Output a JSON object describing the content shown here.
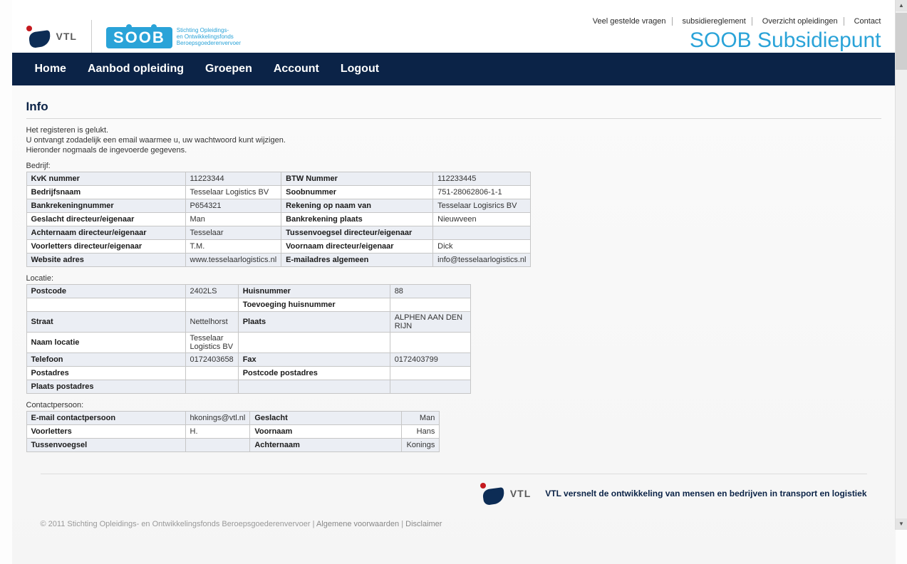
{
  "top_links": {
    "faq": "Veel gestelde vragen",
    "reglement": "subsidiereglement",
    "overzicht": "Overzicht opleidingen",
    "contact": "Contact"
  },
  "logos": {
    "vtl_text": "VTL",
    "soob_text": "SOOB",
    "soob_sub1": "Stichting Opleidings-",
    "soob_sub2": "en Ontwikkelingsfonds",
    "soob_sub3": "Beroepsgoederenvervoer"
  },
  "brand": "SOOB Subsidiepunt",
  "nav": {
    "home": "Home",
    "aanbod": "Aanbod opleiding",
    "groepen": "Groepen",
    "account": "Account",
    "logout": "Logout"
  },
  "title": "Info",
  "intro": {
    "l1": "Het registeren is gelukt.",
    "l2": "U ontvangt zodadelijk een email waarmee u, uw wachtwoord kunt wijzigen.",
    "l3": "Hieronder nogmaals de ingevoerde gegevens."
  },
  "company": {
    "section": "Bedrijf:",
    "rows": [
      {
        "l1": "KvK nummer",
        "v1": "11223344",
        "l2": "BTW Nummer",
        "v2": "112233445"
      },
      {
        "l1": "Bedrijfsnaam",
        "v1": "Tesselaar Logistics BV",
        "l2": "Soobnummer",
        "v2": "751-28062806-1-1"
      },
      {
        "l1": "Bankrekeningnummer",
        "v1": "P654321",
        "l2": "Rekening op naam van",
        "v2": "Tesselaar Logisrics BV"
      },
      {
        "l1": "Geslacht  directeur/eigenaar",
        "v1": "Man",
        "l2": "Bankrekening plaats",
        "v2": "Nieuwveen"
      },
      {
        "l1": "Achternaam  directeur/eigenaar",
        "v1": "Tesselaar",
        "l2": "Tussenvoegsel  directeur/eigenaar",
        "v2": ""
      },
      {
        "l1": "Voorletters  directeur/eigenaar",
        "v1": "T.M.",
        "l2": "Voornaam  directeur/eigenaar",
        "v2": "Dick"
      },
      {
        "l1": "Website adres",
        "v1": "www.tesselaarlogistics.nl",
        "l2": "E-mailadres algemeen",
        "v2": "info@tesselaarlogistics.nl"
      }
    ]
  },
  "location": {
    "section": "Locatie:",
    "rows": [
      {
        "l1": "Postcode",
        "v1": "2402LS",
        "l2": "Huisnummer",
        "v2": "88"
      },
      {
        "l1": "",
        "v1": "",
        "l2": "Toevoeging huisnummer",
        "v2": ""
      },
      {
        "l1": "Straat",
        "v1": "Nettelhorst",
        "l2": "Plaats",
        "v2": "ALPHEN AAN DEN RIJN"
      },
      {
        "l1": "Naam locatie",
        "v1": "Tesselaar Logistics BV",
        "l2": "",
        "v2": ""
      },
      {
        "l1": "Telefoon",
        "v1": "0172403658",
        "l2": "Fax",
        "v2": "0172403799"
      },
      {
        "l1": "Postadres",
        "v1": "",
        "l2": "Postcode postadres",
        "v2": ""
      },
      {
        "l1": "Plaats postadres",
        "v1": "",
        "l2": "",
        "v2": ""
      }
    ]
  },
  "contact": {
    "section": "Contactpersoon:",
    "rows": [
      {
        "l1": "E-mail contactpersoon",
        "v1": "hkonings@vtl.nl",
        "l2": "Geslacht",
        "v2": "Man"
      },
      {
        "l1": "Voorletters",
        "v1": "H.",
        "l2": "Voornaam",
        "v2": "Hans"
      },
      {
        "l1": "Tussenvoegsel",
        "v1": "",
        "l2": "Achternaam",
        "v2": "Konings"
      }
    ]
  },
  "footer": {
    "slogan": "VTL versnelt de ontwikkeling van mensen en bedrijven in transport en logistiek",
    "copyright": "© 2011 Stichting Opleidings- en Ontwikkelingsfonds Beroepsgoederenvervoer",
    "sep": " | ",
    "terms": "Algemene voorwaarden",
    "disclaimer": "Disclaimer"
  }
}
